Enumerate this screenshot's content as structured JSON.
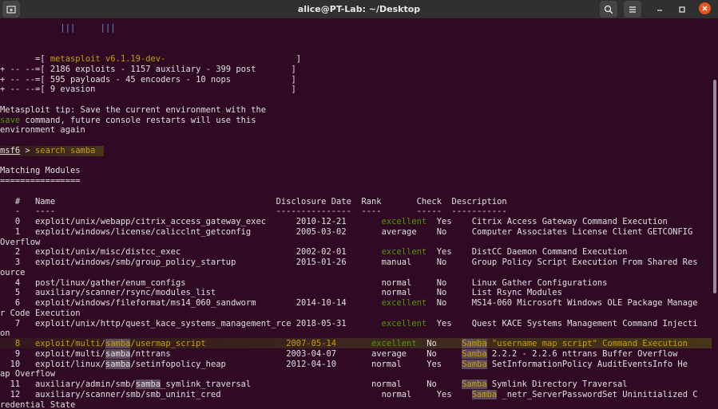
{
  "window": {
    "title": "alice@PT-Lab: ~/Desktop",
    "buttons": {
      "new_tab": "new-tab-icon",
      "search": "search-icon",
      "menu": "hamburger-icon",
      "minimize": "minimize-icon",
      "maximize": "maximize-icon",
      "close": "close-icon"
    },
    "accent_color": "#e95420",
    "background_color": "#300a24"
  },
  "terminal": {
    "banner_bars": "            |||     |||",
    "banner": {
      "l1_pre": "       =[ ",
      "l1_version": "metasploit v6.1.19-dev-",
      "l1_post": "                          ]",
      "l2": "+ -- --=[ 2186 exploits - 1157 auxiliary - 399 post       ]",
      "l3": "+ -- --=[ 595 payloads - 45 encoders - 10 nops            ]",
      "l4": "+ -- --=[ 9 evasion                                       ]"
    },
    "tip": {
      "l1": "Metasploit tip: Save the current environment with the",
      "l2_cmd": "save",
      "l2_rest": " command, future console restarts will use this",
      "l3": "environment again"
    },
    "prompt": {
      "name": "msf6",
      "sep": " > ",
      "command": "search samba"
    },
    "section_title": "Matching Modules",
    "section_rule": "================",
    "table_header": "   #   Name                                            Disclosure Date  Rank       Check  Description",
    "table_rule": "   -   ----                                            ---------------  ----       -----  -----------",
    "rows": [
      {
        "num": "   0",
        "name": "exploit/unix/webapp/citrix_access_gateway_exec      ",
        "date": "2010-12-21",
        "rank": "excellent",
        "check": "Yes",
        "desc": "Citrix Access Gateway Command Execution"
      },
      {
        "num": "   1",
        "name": "exploit/windows/license/calicclnt_getconfig         ",
        "date": "2005-03-02",
        "rank": "average  ",
        "check": "No ",
        "desc": "Computer Associates License Client GETCONFIG",
        "wrap": "Overflow"
      },
      {
        "num": "   2",
        "name": "exploit/unix/misc/distcc_exec                       ",
        "date": "2002-02-01",
        "rank": "excellent",
        "check": "Yes",
        "desc": "DistCC Daemon Command Execution"
      },
      {
        "num": "   3",
        "name": "exploit/windows/smb/group_policy_startup            ",
        "date": "2015-01-26",
        "rank": "manual   ",
        "check": "No ",
        "desc": "Group Policy Script Execution From Shared Res",
        "wrap": "ource"
      },
      {
        "num": "   4",
        "name": "post/linux/gather/enum_configs                      ",
        "date": "          ",
        "rank": "normal   ",
        "check": "No ",
        "desc": "Linux Gather Configurations"
      },
      {
        "num": "   5",
        "name": "auxiliary/scanner/rsync/modules_list                ",
        "date": "          ",
        "rank": "normal   ",
        "check": "No ",
        "desc": "List Rsync Modules"
      },
      {
        "num": "   6",
        "name": "exploit/windows/fileformat/ms14_060_sandworm        ",
        "date": "2014-10-14",
        "rank": "excellent",
        "check": "No ",
        "desc": "MS14-060 Microsoft Windows OLE Package Manage",
        "wrap": "r Code Execution"
      },
      {
        "num": "   7",
        "name": "exploit/unix/http/quest_kace_systems_management_rce ",
        "date": "2018-05-31",
        "rank": "excellent",
        "check": "Yes",
        "desc": "Quest KACE Systems Management Command Injecti",
        "wrap": "on"
      },
      {
        "num": "   8",
        "pre": "exploit/multi/",
        "hit": "samba",
        "post": "/usermap_script                ",
        "date": "2007-05-14",
        "rank": "excellent",
        "check": "No ",
        "desc_hit": "Samba",
        "desc": " \"username map script\" Command Execution"
      },
      {
        "num": "   9",
        "pre": "exploit/multi/",
        "hit": "samba",
        "post": "/nttrans                       ",
        "date": "2003-04-07",
        "rank": "average  ",
        "check": "No ",
        "desc_hit": "Samba",
        "desc": " 2.2.2 - 2.2.6 nttrans Buffer Overflow"
      },
      {
        "num": "  10",
        "pre": "exploit/linux/",
        "hit": "samba",
        "post": "/setinfopolicy_heap            ",
        "date": "2012-04-10",
        "rank": "normal   ",
        "check": "Yes",
        "desc_hit": "Samba",
        "desc": " SetInformationPolicy AuditEventsInfo He",
        "wrap": "ap Overflow"
      },
      {
        "num": "  11",
        "pre": "auxiliary/admin/smb/",
        "hit": "samba",
        "post": "_symlink_traversal       ",
        "date": "          ",
        "rank": "normal   ",
        "check": "No ",
        "desc_hit": "Samba",
        "desc": " Symlink Directory Traversal"
      },
      {
        "num": "  12",
        "pre": "auxiliary/scanner/smb/smb_uninit_cred",
        "hit": "",
        "post": "               ",
        "date": "          ",
        "rank": "normal   ",
        "check": "Yes",
        "desc_hit": "Samba",
        "desc": " _netr_ServerPasswordSet Uninitialized C",
        "wrap": "redential State"
      }
    ]
  }
}
